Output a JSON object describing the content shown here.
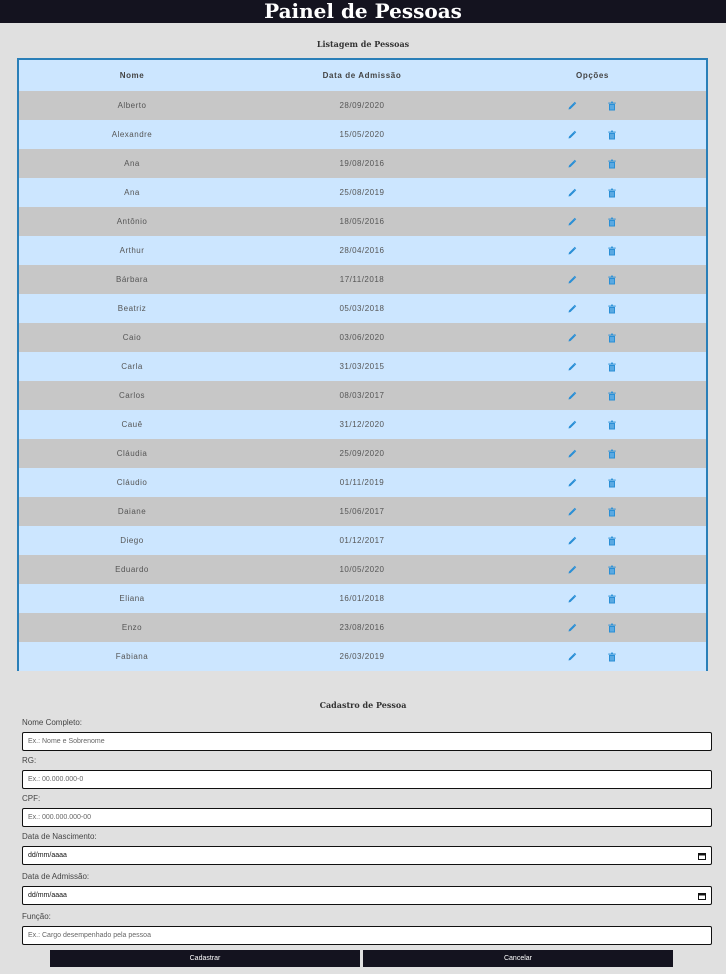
{
  "header": {
    "title": "Painel de Pessoas"
  },
  "list": {
    "title": "Listagem de Pessoas",
    "columns": [
      "Nome",
      "Data de Admissão",
      "Opções"
    ],
    "rows": [
      {
        "name": "Alberto",
        "date": "28/09/2020"
      },
      {
        "name": "Alexandre",
        "date": "15/05/2020"
      },
      {
        "name": "Ana",
        "date": "19/08/2016"
      },
      {
        "name": "Ana",
        "date": "25/08/2019"
      },
      {
        "name": "Antônio",
        "date": "18/05/2016"
      },
      {
        "name": "Arthur",
        "date": "28/04/2016"
      },
      {
        "name": "Bárbara",
        "date": "17/11/2018"
      },
      {
        "name": "Beatriz",
        "date": "05/03/2018"
      },
      {
        "name": "Caio",
        "date": "03/06/2020"
      },
      {
        "name": "Carla",
        "date": "31/03/2015"
      },
      {
        "name": "Carlos",
        "date": "08/03/2017"
      },
      {
        "name": "Cauê",
        "date": "31/12/2020"
      },
      {
        "name": "Cláudia",
        "date": "25/09/2020"
      },
      {
        "name": "Cláudio",
        "date": "01/11/2019"
      },
      {
        "name": "Daiane",
        "date": "15/06/2017"
      },
      {
        "name": "Diego",
        "date": "01/12/2017"
      },
      {
        "name": "Eduardo",
        "date": "10/05/2020"
      },
      {
        "name": "Eliana",
        "date": "16/01/2018"
      },
      {
        "name": "Enzo",
        "date": "23/08/2016"
      },
      {
        "name": "Fabiana",
        "date": "26/03/2019"
      }
    ],
    "icons": {
      "edit": "pencil-icon",
      "delete": "trash-icon",
      "color": "#2a8fd6"
    }
  },
  "form": {
    "title": "Cadastro de Pessoa",
    "fields": [
      {
        "label": "Nome Completo:",
        "placeholder": "Ex.: Nome e Sobrenome"
      },
      {
        "label": "RG:",
        "placeholder": "Ex.: 00.000.000-0"
      },
      {
        "label": "CPF:",
        "placeholder": "Ex.: 000.000.000-00"
      },
      {
        "label": "Data de Nascimento:",
        "placeholder": "dd/mm/aaaa"
      },
      {
        "label": "Data de Admissão:",
        "placeholder": "dd/mm/aaaa"
      },
      {
        "label": "Função:",
        "placeholder": "Ex.: Cargo desempenhado pela pessoa"
      }
    ],
    "submit_label": "Cadastrar",
    "cancel_label": "Cancelar"
  },
  "colors": {
    "header_bg": "#14131f",
    "row_alt": "#c7c7c7",
    "row_light": "#cce6ff",
    "border": "#2a7fb8"
  }
}
